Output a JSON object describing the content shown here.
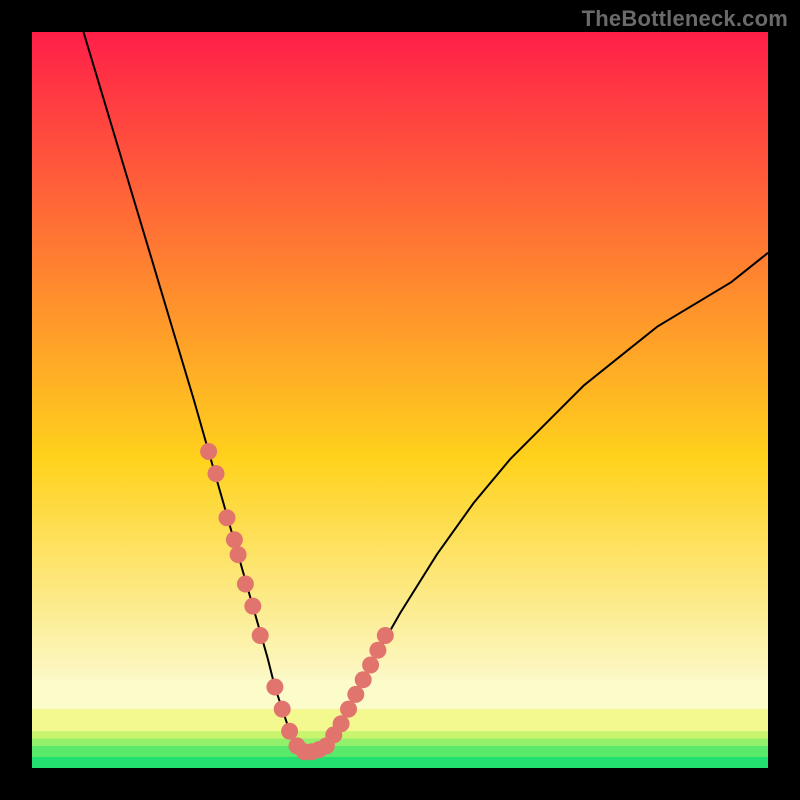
{
  "watermark": "TheBottleneck.com",
  "chart_data": {
    "type": "line",
    "title": "",
    "xlabel": "",
    "ylabel": "",
    "xlim": [
      0,
      100
    ],
    "ylim": [
      0,
      100
    ],
    "series": [
      {
        "name": "curve",
        "x": [
          7,
          10,
          13,
          16,
          19,
          22,
          24,
          26,
          28,
          30,
          32,
          33,
          34,
          35,
          36,
          37,
          38,
          40,
          42,
          44,
          46,
          50,
          55,
          60,
          65,
          70,
          75,
          80,
          85,
          90,
          95,
          100
        ],
        "y": [
          100,
          90,
          80,
          70,
          60,
          50,
          43,
          36,
          29,
          22,
          15,
          11,
          8,
          5,
          3,
          2,
          2,
          3,
          6,
          10,
          14,
          21,
          29,
          36,
          42,
          47,
          52,
          56,
          60,
          63,
          66,
          70
        ]
      }
    ],
    "markers": {
      "name": "dots",
      "x": [
        24,
        25,
        26.5,
        27.5,
        28,
        29,
        30,
        31,
        33,
        34,
        35,
        36,
        37,
        38,
        39,
        40,
        41,
        42,
        43,
        44,
        45,
        46,
        47,
        48
      ],
      "y": [
        43,
        40,
        34,
        31,
        29,
        25,
        22,
        18,
        11,
        8,
        5,
        3,
        2.2,
        2.2,
        2.5,
        3,
        4.5,
        6,
        8,
        10,
        12,
        14,
        16,
        18
      ]
    },
    "bands": [
      {
        "y0": 0.0,
        "y1": 1.5,
        "color": "#22e06f"
      },
      {
        "y0": 1.5,
        "y1": 3.0,
        "color": "#5be96b"
      },
      {
        "y0": 3.0,
        "y1": 4.0,
        "color": "#93f06a"
      },
      {
        "y0": 4.0,
        "y1": 5.0,
        "color": "#c9f56e"
      },
      {
        "y0": 5.0,
        "y1": 8.0,
        "color": "#f3f98f"
      },
      {
        "y0": 8.0,
        "y1": 12.0,
        "color": "#fcfccb"
      }
    ],
    "gradient_top": "#ff1f49",
    "gradient_mid": "#ffd21c",
    "gradient_light": "#fbfbd2",
    "gradient_green": "#22e06f",
    "marker_color": "#e2746e",
    "curve_color": "#000000"
  }
}
